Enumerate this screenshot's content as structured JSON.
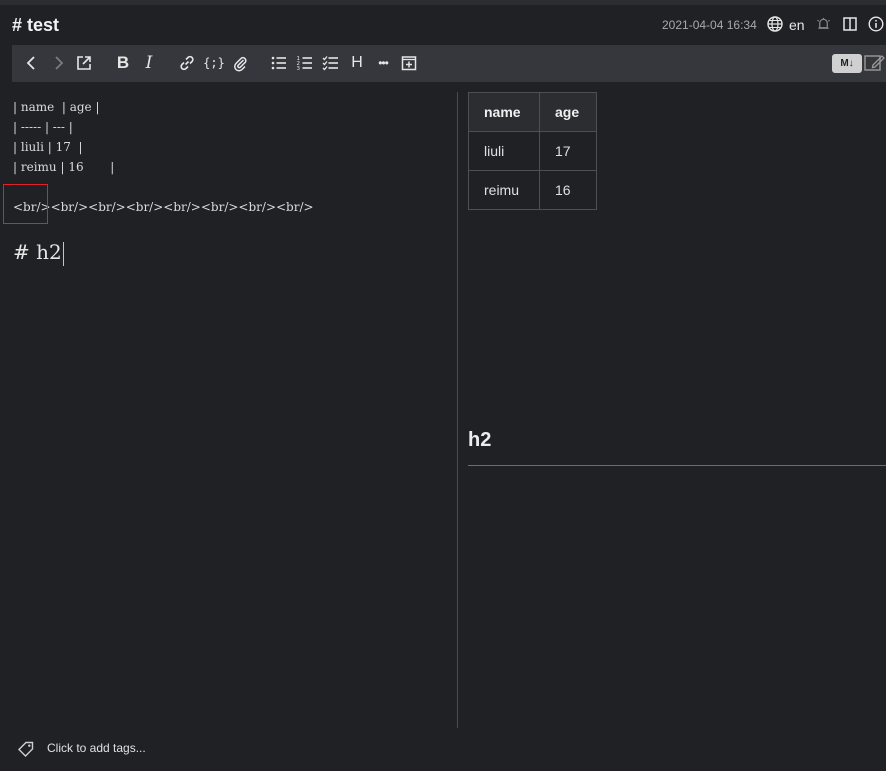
{
  "header": {
    "title": "# test",
    "date": "2021-04-04 16:34",
    "lang": "en"
  },
  "toolbar": {
    "items": [
      "chevron-left-icon",
      "chevron-right-icon",
      "external-link-icon",
      "bold-icon",
      "italic-icon",
      "link-icon",
      "code-icon",
      "attachment-icon",
      "bullet-list-icon",
      "numbered-list-icon",
      "checklist-icon",
      "heading-icon",
      "more-icon",
      "add-block-icon"
    ],
    "bold_label": "B",
    "italic_label": "I",
    "heading_label": "H",
    "code_label": "{;}",
    "more_label": "•••",
    "md_badge": "M↓"
  },
  "editor": {
    "lines": [
      "| name  | age |",
      "| ----- | --- |",
      "| liuli | 17  |",
      "| reimu | 16       |",
      "<br/><br/><br/><br/><br/><br/><br/><br/>",
      "# h2"
    ]
  },
  "preview": {
    "table": {
      "headers": [
        "name",
        "age"
      ],
      "rows": [
        [
          "liuli",
          "17"
        ],
        [
          "reimu",
          "16"
        ]
      ]
    },
    "h2": "h2"
  },
  "footer": {
    "tags_placeholder": "Click to add tags..."
  },
  "colors": {
    "background": "#1f2125",
    "toolbar": "#35373c",
    "highlight": "#e0202a",
    "caret": "#e8c46a"
  }
}
